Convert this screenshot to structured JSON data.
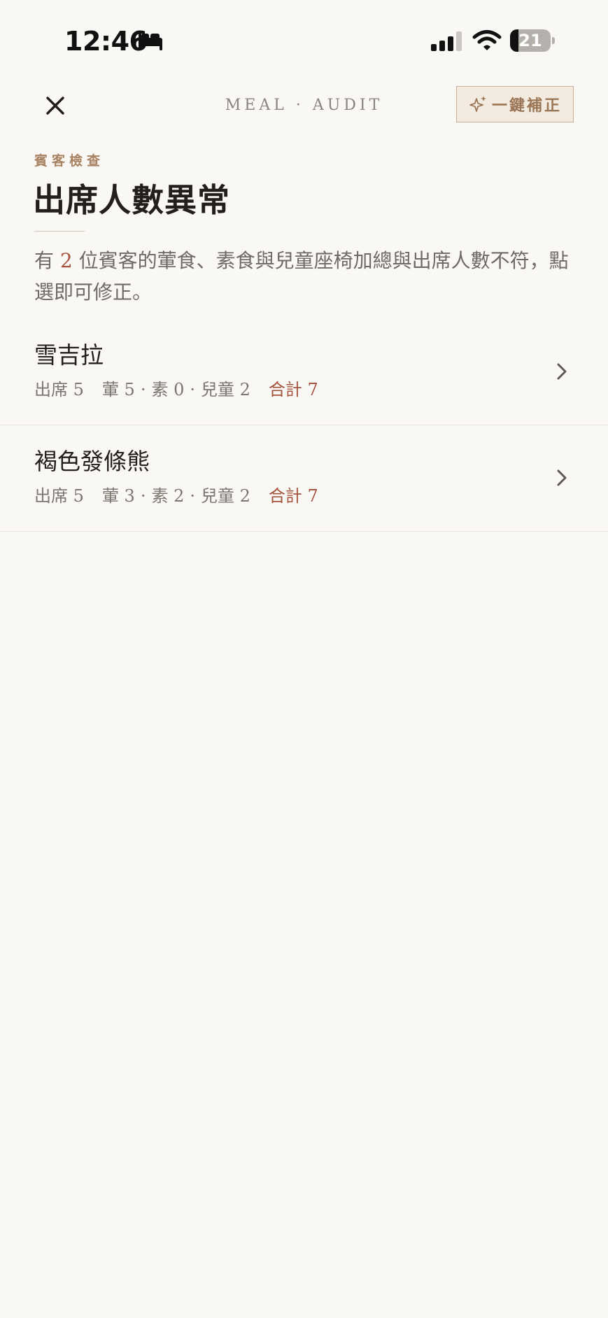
{
  "status_bar": {
    "time": "12:46",
    "battery_level": "21",
    "battery_fraction": 0.21,
    "icons": [
      "bed-icon",
      "cellular-signal-icon",
      "wifi-icon",
      "battery-icon"
    ]
  },
  "nav": {
    "close_icon": "close-icon",
    "title": "MEAL · AUDIT",
    "autofix_icon": "sparkle-icon",
    "autofix_label": "一鍵補正"
  },
  "section": {
    "kicker": "賓客檢查",
    "title": "出席人數異常"
  },
  "description": {
    "prefix": "有 ",
    "count": "2",
    "suffix": " 位賓客的葷食、素食與兒童座椅加總與出席人數不符，點選即可修正。"
  },
  "guests": [
    {
      "name": "雪吉拉",
      "attendance": "出席 5",
      "meat": "葷 5",
      "veg": "素 0",
      "kids": "兒童 2",
      "total": "合計 7"
    },
    {
      "name": "褐色發條熊",
      "attendance": "出席 5",
      "meat": "葷 3",
      "veg": "素 2",
      "kids": "兒童 2",
      "total": "合計 7"
    }
  ],
  "separator": "·",
  "colors": {
    "background": "#faf8f5",
    "accent": "#a4533d",
    "gold": "#a88362",
    "button_fill": "#f4ebe0",
    "button_border": "#c9ae92"
  }
}
